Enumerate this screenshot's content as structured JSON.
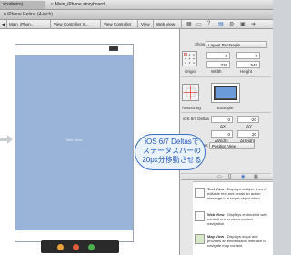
{
  "titlebar": {
    "tab_1": "xcodeproj",
    "tab_2": "Main_iPhone.storyboard"
  },
  "pathbar": {
    "text": "n iPhone Retina (4-inch)"
  },
  "jumpbar": {
    "crumbs": [
      "Main_iPhon...",
      "View Controller S...",
      "View Controller",
      "View",
      "Web View"
    ]
  },
  "canvas": {
    "content_label": "Web View"
  },
  "inspector": {
    "show_label": "Show",
    "show_value": "Layout Rectangle",
    "x": "0",
    "y": "0",
    "width": "320",
    "height": "548",
    "origin_label": "Origin",
    "width_label": "Width",
    "height_label": "Height",
    "autosizing_label": "Autosizing",
    "example_label": "Example",
    "deltas_label": "iOS 6/7 Deltas",
    "delta_x": "0",
    "delta_y": "-20",
    "delta_w": "0",
    "delta_h": "20",
    "dx_label": "ΔX",
    "dy_label": "ΔY",
    "dw_label": "ΔWidth",
    "dh_label": "ΔHeight",
    "view_as_label": "View as",
    "view_as_value": "Position View"
  },
  "bubble": {
    "text": "iOS 6/7 Deltasでステータスバーの20px分移動させる"
  },
  "library": {
    "items": [
      {
        "name": "Text View",
        "desc": "Displays multiple lines of editable text and sends an action message to a target object when..."
      },
      {
        "name": "Web View",
        "desc": "Displays embedded web content and enables content navigation."
      },
      {
        "name": "Map View",
        "desc": "Displays maps and provides an embeddable interface to navigate map content."
      }
    ]
  },
  "colors": {
    "content_blue": "#99b4d8",
    "bubble_blue": "#1f55b5",
    "red_guide": "#e0463c"
  }
}
